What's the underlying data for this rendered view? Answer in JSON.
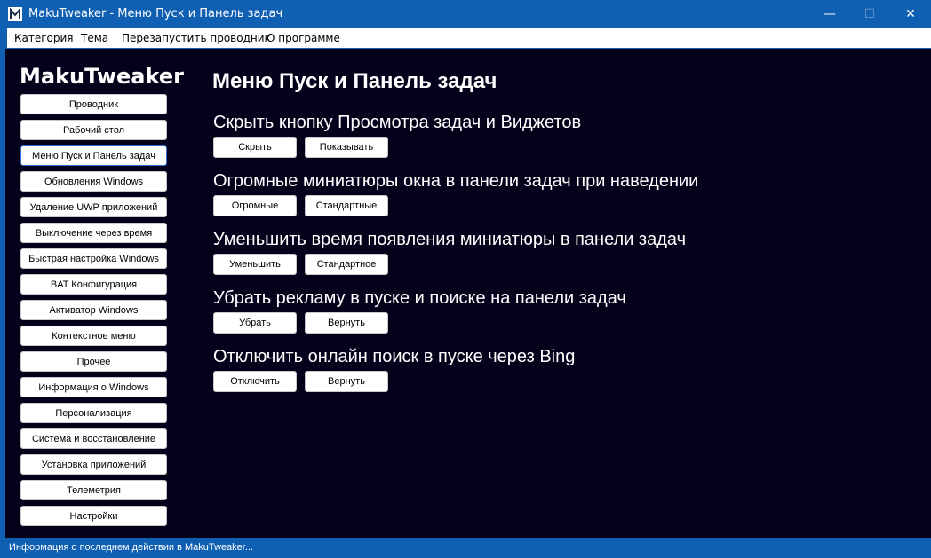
{
  "window": {
    "title": "MakuTweaker - Меню Пуск и Панель задач",
    "controls": {
      "minimize": "—",
      "maximize": "☐",
      "close": "✕"
    }
  },
  "menu": [
    "Категория",
    "Тема",
    "Перезапустить проводник",
    "О программе"
  ],
  "sidebar": {
    "app_title": "MakuTweaker",
    "items": [
      "Проводник",
      "Рабочий стол",
      "Меню Пуск и Панель задач",
      "Обновления Windows",
      "Удаление UWP приложений",
      "Выключение через время",
      "Быстрая настройка Windows",
      "BAT Конфигурация",
      "Активатор Windows",
      "Контекстное меню",
      "Прочее",
      "Информация о Windows",
      "Персонализация",
      "Система и восстановление",
      "Установка приложений",
      "Телеметрия",
      "Настройки"
    ],
    "active_index": 2
  },
  "main": {
    "title": "Меню Пуск и Панель задач",
    "sections": [
      {
        "title": "Скрыть кнопку Просмотра задач и Виджетов",
        "buttons": [
          "Скрыть",
          "Показывать"
        ]
      },
      {
        "title": "Огромные миниатюры окна в панели задач при наведении",
        "buttons": [
          "Огромные",
          "Стандартные"
        ]
      },
      {
        "title": "Уменьшить время появления миниатюры в панели задач",
        "buttons": [
          "Уменьшить",
          "Стандартное"
        ]
      },
      {
        "title": "Убрать рекламу в пуске и поиске на панели задач",
        "buttons": [
          "Убрать",
          "Вернуть"
        ]
      },
      {
        "title": "Отключить онлайн поиск в пуске через Bing",
        "buttons": [
          "Отключить",
          "Вернуть"
        ]
      }
    ]
  },
  "status": {
    "text": "Информация о последнем действии в MakuTweaker..."
  },
  "colors": {
    "titlebar": "#0f5fb2",
    "content_bg": "#04011a",
    "button_bg": "#ffffff",
    "active_border": "#2a6fd6"
  },
  "icons": {
    "app": "maku-logo-icon"
  }
}
